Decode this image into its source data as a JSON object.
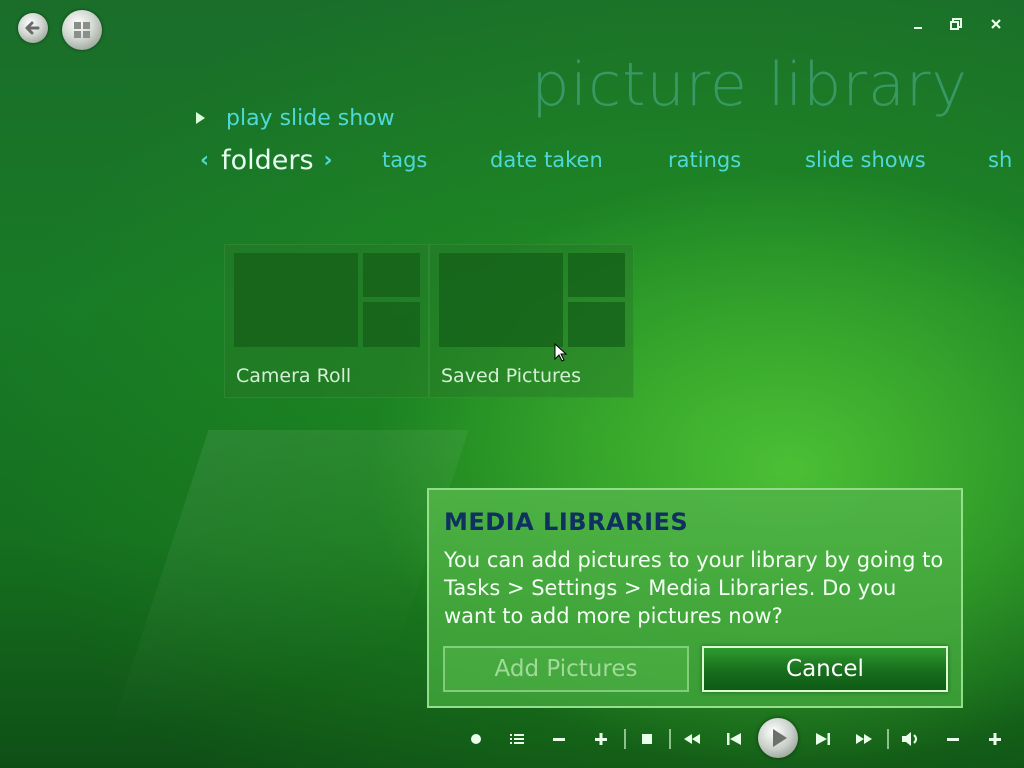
{
  "window": {
    "back_icon": "back-arrow-icon",
    "start_icon": "windows-logo-icon",
    "minimize": "–",
    "restore": "▫",
    "close": "×"
  },
  "page": {
    "title": "picture library",
    "play_slide_show": "play slide show"
  },
  "nav": {
    "active": "folders",
    "left_arrow": "‹",
    "right_arrow": "›",
    "items": [
      "tags",
      "date taken",
      "ratings",
      "slide shows",
      "sh"
    ]
  },
  "folders": [
    {
      "label": "Camera Roll"
    },
    {
      "label": "Saved Pictures"
    }
  ],
  "dialog": {
    "title": "MEDIA LIBRARIES",
    "body": "You can add pictures to your library by going to Tasks > Settings > Media Libraries. Do you want to add more pictures now?",
    "add_button": "Add Pictures",
    "cancel_button": "Cancel"
  },
  "transport": {
    "record": "●",
    "guide": "☰",
    "channel_down": "−",
    "channel_up": "+",
    "stop": "■",
    "rewind": "◀◀",
    "previous": "⏮",
    "play": "▶",
    "next": "⏭",
    "fast_forward": "▶▶",
    "mute": "🔈",
    "volume_down": "−",
    "volume_up": "+"
  },
  "colors": {
    "accent": "#4fd8d6",
    "dialog_title": "#0f3060"
  }
}
